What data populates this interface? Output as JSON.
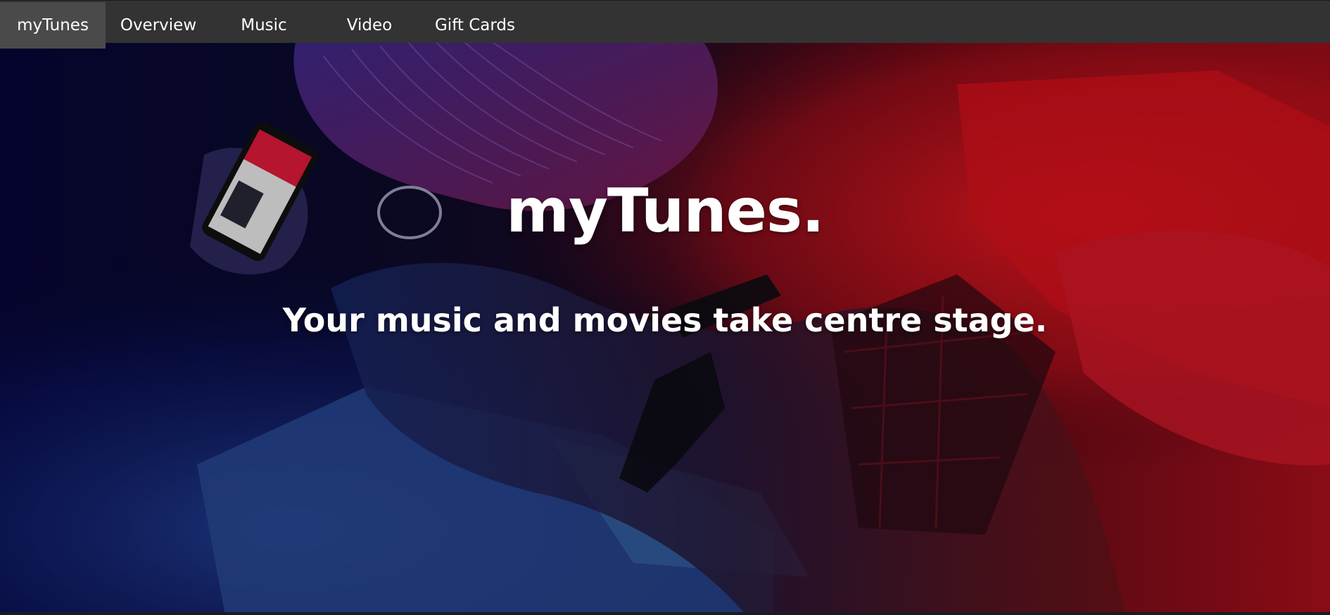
{
  "nav": {
    "items": [
      {
        "label": "myTunes",
        "active": true
      },
      {
        "label": "Overview",
        "active": false
      },
      {
        "label": "Music",
        "active": false
      },
      {
        "label": "Video",
        "active": false
      },
      {
        "label": "Gift Cards",
        "active": false
      }
    ]
  },
  "hero": {
    "title": "myTunes.",
    "subtitle": "Your music and movies take centre stage.",
    "image_description_colors": {
      "left": "#0a0a5a",
      "right": "#d0101a",
      "dark": "#050418"
    }
  },
  "theme": {
    "nav_bg": "#333333",
    "nav_active_bg": "#4a4a4a",
    "text": "#ffffff"
  }
}
